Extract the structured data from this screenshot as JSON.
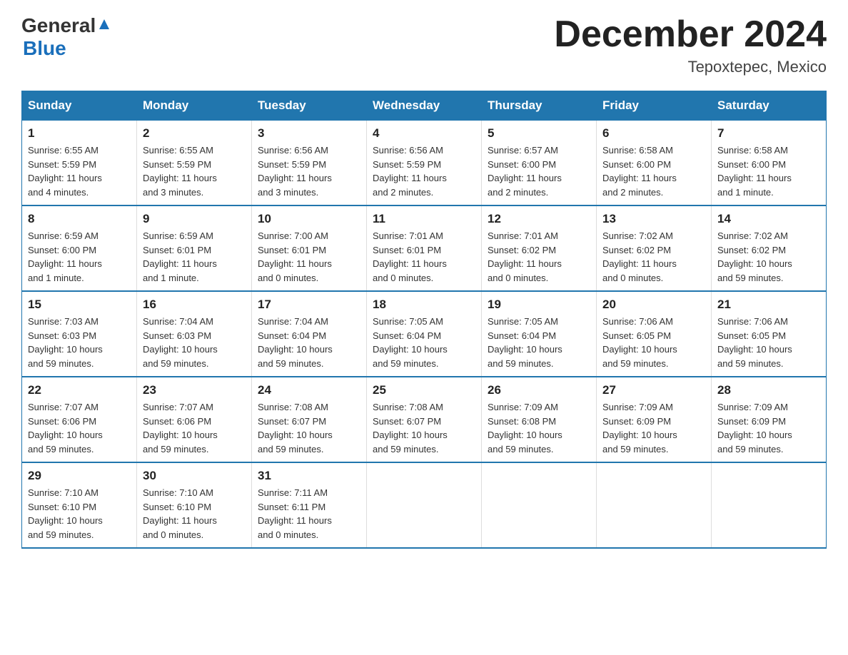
{
  "header": {
    "logo_general": "General",
    "logo_blue": "Blue",
    "month_title": "December 2024",
    "location": "Tepoxtepec, Mexico"
  },
  "weekdays": [
    "Sunday",
    "Monday",
    "Tuesday",
    "Wednesday",
    "Thursday",
    "Friday",
    "Saturday"
  ],
  "weeks": [
    [
      {
        "day": "1",
        "sunrise": "6:55 AM",
        "sunset": "5:59 PM",
        "daylight": "11 hours and 4 minutes."
      },
      {
        "day": "2",
        "sunrise": "6:55 AM",
        "sunset": "5:59 PM",
        "daylight": "11 hours and 3 minutes."
      },
      {
        "day": "3",
        "sunrise": "6:56 AM",
        "sunset": "5:59 PM",
        "daylight": "11 hours and 3 minutes."
      },
      {
        "day": "4",
        "sunrise": "6:56 AM",
        "sunset": "5:59 PM",
        "daylight": "11 hours and 2 minutes."
      },
      {
        "day": "5",
        "sunrise": "6:57 AM",
        "sunset": "6:00 PM",
        "daylight": "11 hours and 2 minutes."
      },
      {
        "day": "6",
        "sunrise": "6:58 AM",
        "sunset": "6:00 PM",
        "daylight": "11 hours and 2 minutes."
      },
      {
        "day": "7",
        "sunrise": "6:58 AM",
        "sunset": "6:00 PM",
        "daylight": "11 hours and 1 minute."
      }
    ],
    [
      {
        "day": "8",
        "sunrise": "6:59 AM",
        "sunset": "6:00 PM",
        "daylight": "11 hours and 1 minute."
      },
      {
        "day": "9",
        "sunrise": "6:59 AM",
        "sunset": "6:01 PM",
        "daylight": "11 hours and 1 minute."
      },
      {
        "day": "10",
        "sunrise": "7:00 AM",
        "sunset": "6:01 PM",
        "daylight": "11 hours and 0 minutes."
      },
      {
        "day": "11",
        "sunrise": "7:01 AM",
        "sunset": "6:01 PM",
        "daylight": "11 hours and 0 minutes."
      },
      {
        "day": "12",
        "sunrise": "7:01 AM",
        "sunset": "6:02 PM",
        "daylight": "11 hours and 0 minutes."
      },
      {
        "day": "13",
        "sunrise": "7:02 AM",
        "sunset": "6:02 PM",
        "daylight": "11 hours and 0 minutes."
      },
      {
        "day": "14",
        "sunrise": "7:02 AM",
        "sunset": "6:02 PM",
        "daylight": "10 hours and 59 minutes."
      }
    ],
    [
      {
        "day": "15",
        "sunrise": "7:03 AM",
        "sunset": "6:03 PM",
        "daylight": "10 hours and 59 minutes."
      },
      {
        "day": "16",
        "sunrise": "7:04 AM",
        "sunset": "6:03 PM",
        "daylight": "10 hours and 59 minutes."
      },
      {
        "day": "17",
        "sunrise": "7:04 AM",
        "sunset": "6:04 PM",
        "daylight": "10 hours and 59 minutes."
      },
      {
        "day": "18",
        "sunrise": "7:05 AM",
        "sunset": "6:04 PM",
        "daylight": "10 hours and 59 minutes."
      },
      {
        "day": "19",
        "sunrise": "7:05 AM",
        "sunset": "6:04 PM",
        "daylight": "10 hours and 59 minutes."
      },
      {
        "day": "20",
        "sunrise": "7:06 AM",
        "sunset": "6:05 PM",
        "daylight": "10 hours and 59 minutes."
      },
      {
        "day": "21",
        "sunrise": "7:06 AM",
        "sunset": "6:05 PM",
        "daylight": "10 hours and 59 minutes."
      }
    ],
    [
      {
        "day": "22",
        "sunrise": "7:07 AM",
        "sunset": "6:06 PM",
        "daylight": "10 hours and 59 minutes."
      },
      {
        "day": "23",
        "sunrise": "7:07 AM",
        "sunset": "6:06 PM",
        "daylight": "10 hours and 59 minutes."
      },
      {
        "day": "24",
        "sunrise": "7:08 AM",
        "sunset": "6:07 PM",
        "daylight": "10 hours and 59 minutes."
      },
      {
        "day": "25",
        "sunrise": "7:08 AM",
        "sunset": "6:07 PM",
        "daylight": "10 hours and 59 minutes."
      },
      {
        "day": "26",
        "sunrise": "7:09 AM",
        "sunset": "6:08 PM",
        "daylight": "10 hours and 59 minutes."
      },
      {
        "day": "27",
        "sunrise": "7:09 AM",
        "sunset": "6:09 PM",
        "daylight": "10 hours and 59 minutes."
      },
      {
        "day": "28",
        "sunrise": "7:09 AM",
        "sunset": "6:09 PM",
        "daylight": "10 hours and 59 minutes."
      }
    ],
    [
      {
        "day": "29",
        "sunrise": "7:10 AM",
        "sunset": "6:10 PM",
        "daylight": "10 hours and 59 minutes."
      },
      {
        "day": "30",
        "sunrise": "7:10 AM",
        "sunset": "6:10 PM",
        "daylight": "11 hours and 0 minutes."
      },
      {
        "day": "31",
        "sunrise": "7:11 AM",
        "sunset": "6:11 PM",
        "daylight": "11 hours and 0 minutes."
      },
      null,
      null,
      null,
      null
    ]
  ],
  "labels": {
    "sunrise": "Sunrise:",
    "sunset": "Sunset:",
    "daylight": "Daylight:"
  },
  "accent_color": "#2176ae"
}
